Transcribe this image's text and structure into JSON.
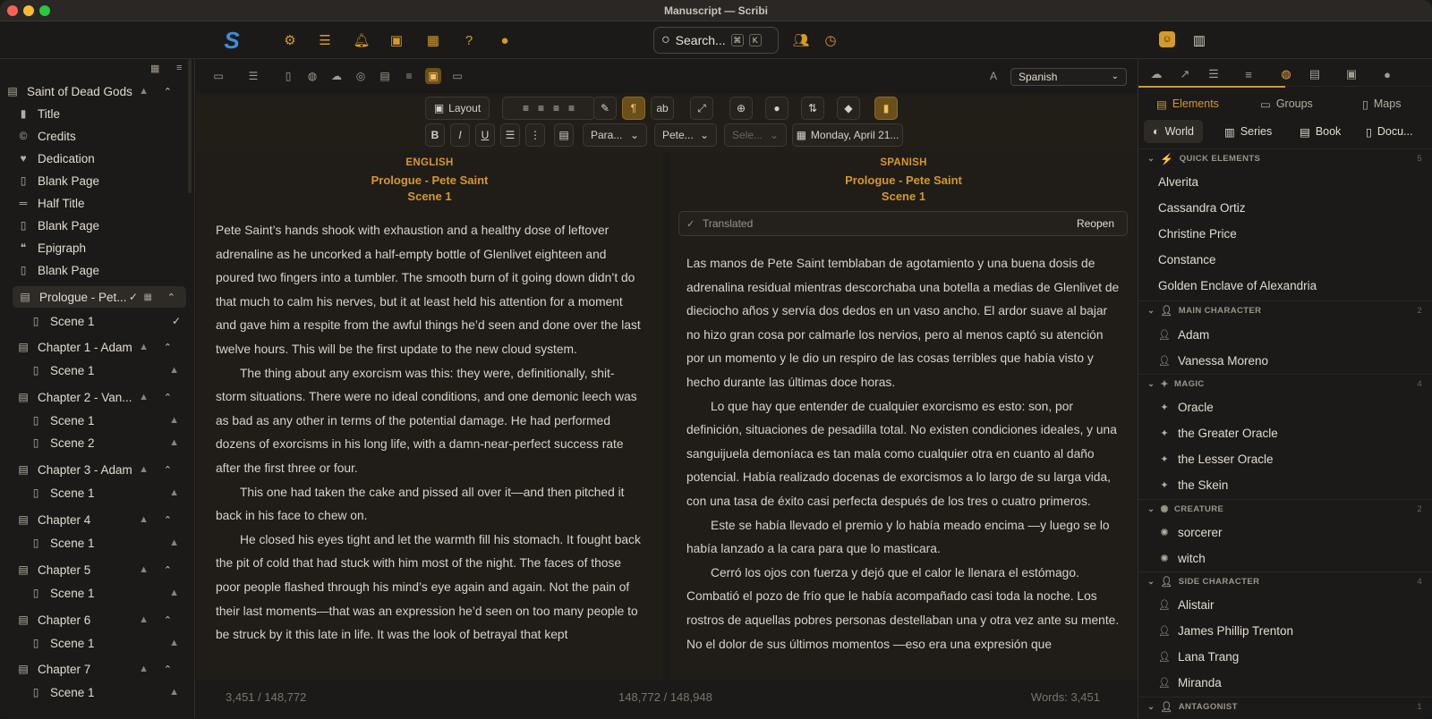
{
  "window": {
    "title": "Manuscript — Scribi"
  },
  "toolbar": {
    "search_label": "Search...",
    "shortcut_cmd": "⌘",
    "shortcut_key": "K"
  },
  "sidebar": {
    "items": [
      {
        "label": "Saint of Dead Gods",
        "type": "book"
      },
      {
        "label": "Title"
      },
      {
        "label": "Credits"
      },
      {
        "label": "Dedication"
      },
      {
        "label": "Blank Page"
      },
      {
        "label": "Half Title"
      },
      {
        "label": "Blank Page"
      },
      {
        "label": "Epigraph"
      },
      {
        "label": "Blank Page"
      },
      {
        "label": "Prologue - Pet..."
      },
      {
        "label": "Scene 1"
      },
      {
        "label": "Chapter 1 - Adam"
      },
      {
        "label": "Scene 1"
      },
      {
        "label": "Chapter 2 - Van..."
      },
      {
        "label": "Scene 1"
      },
      {
        "label": "Scene 2"
      },
      {
        "label": "Chapter 3 - Adam"
      },
      {
        "label": "Scene 1"
      },
      {
        "label": "Chapter 4"
      },
      {
        "label": "Scene 1"
      },
      {
        "label": "Chapter 5"
      },
      {
        "label": "Scene 1"
      },
      {
        "label": "Chapter 6"
      },
      {
        "label": "Scene 1"
      },
      {
        "label": "Chapter 7"
      },
      {
        "label": "Scene 1"
      }
    ]
  },
  "editor": {
    "language": "Spanish",
    "layout_label": "Layout",
    "paragraph_select": "Para...",
    "pov_select": "Pete...",
    "select_placeholder": "Sele...",
    "date": "Monday, April 21...",
    "left": {
      "lang": "ENGLISH",
      "title": "Prologue - Pete Saint",
      "scene": "Scene 1",
      "paragraphs": [
        "Pete Saint’s hands shook with exhaustion and a healthy dose of leftover adrenaline as he uncorked a half-empty bottle of Glenlivet eighteen and poured two fingers into a tumbler. The smooth burn of it going down didn’t do that much to calm his nerves, but it at least held his attention for a moment and gave him a respite from the awful things he’d seen and done over the last twelve hours. This will be the first update to the new cloud system.",
        "The thing about any exorcism was this: they were, definitionally, shit-storm situations. There were no ideal conditions, and one demonic leech was as bad as any other in terms of the potential damage. He had performed dozens of exorcisms in his long life, with a damn-near-perfect success rate after the first three or four.",
        "This one had taken the cake and pissed all over it—and then pitched it back in his face to chew on.",
        "He closed his eyes tight and let the warmth fill his stomach. It fought back the pit of cold that had stuck with him most of the night. The faces of those poor people flashed through his mind’s eye again and again. Not the pain of their last moments—that was an expression he’d seen on too many people to be struck by it this late in life. It was the look of betrayal that kept"
      ]
    },
    "right": {
      "lang": "SPANISH",
      "title": "Prologue - Pete Saint",
      "scene": "Scene 1",
      "status": "Translated",
      "reopen": "Reopen",
      "paragraphs": [
        "Las manos de Pete Saint temblaban de agotamiento y una buena dosis de adrenalina residual mientras descorchaba una botella a medias de Glenlivet de dieciocho años y servía dos dedos en un vaso ancho. El ardor suave al bajar no hizo gran cosa por calmarle los nervios, pero al menos captó su atención por un momento y le dio un respiro de las cosas terribles que había visto y hecho durante las últimas doce horas.",
        "Lo que hay que entender de cualquier exorcismo es esto: son, por definición, situaciones de pesadilla total. No existen condiciones ideales, y una sanguijuela demoníaca es tan mala como cualquier otra en cuanto al daño potencial. Había realizado docenas de exorcismos a lo largo de su larga vida, con una tasa de éxito casi perfecta después de los tres o cuatro primeros.",
        "Este se había llevado el premio y lo había meado encima —y luego se lo había lanzado a la cara para que lo masticara.",
        "Cerró los ojos con fuerza y dejó que el calor le llenara el estómago. Combatió el pozo de frío que le había acompañado casi toda la noche. Los rostros de aquellas pobres personas destellaban una y otra vez ante su mente. No el dolor de sus últimos momentos —eso era una expresión que"
      ]
    },
    "status": {
      "left_count": "3,451 / 148,772",
      "mid_count": "148,772 / 148,948",
      "words": "Words: 3,451"
    }
  },
  "right_panel": {
    "tabs": [
      "Elements",
      "Groups",
      "Maps"
    ],
    "scopes": [
      "World",
      "Series",
      "Book",
      "Docu..."
    ],
    "sections": [
      {
        "name": "QUICK ELEMENTS",
        "count": "5",
        "items": [
          "Alverita",
          "Cassandra Ortiz",
          "Christine Price",
          "Constance",
          "Golden Enclave of Alexandria"
        ]
      },
      {
        "name": "MAIN CHARACTER",
        "count": "2",
        "items": [
          "Adam",
          "Vanessa Moreno"
        ]
      },
      {
        "name": "MAGIC",
        "count": "4",
        "items": [
          "Oracle",
          "the Greater Oracle",
          "the Lesser Oracle",
          "the Skein"
        ]
      },
      {
        "name": "CREATURE",
        "count": "2",
        "items": [
          "sorcerer",
          "witch"
        ]
      },
      {
        "name": "SIDE CHARACTER",
        "count": "4",
        "items": [
          "Alistair",
          "James Phillip Trenton",
          "Lana Trang",
          "Miranda"
        ]
      },
      {
        "name": "ANTAGONIST",
        "count": "1",
        "items": []
      }
    ]
  },
  "colors": {
    "accent": "#d4982c",
    "background": "#1b1917",
    "panel": "#201c17"
  }
}
